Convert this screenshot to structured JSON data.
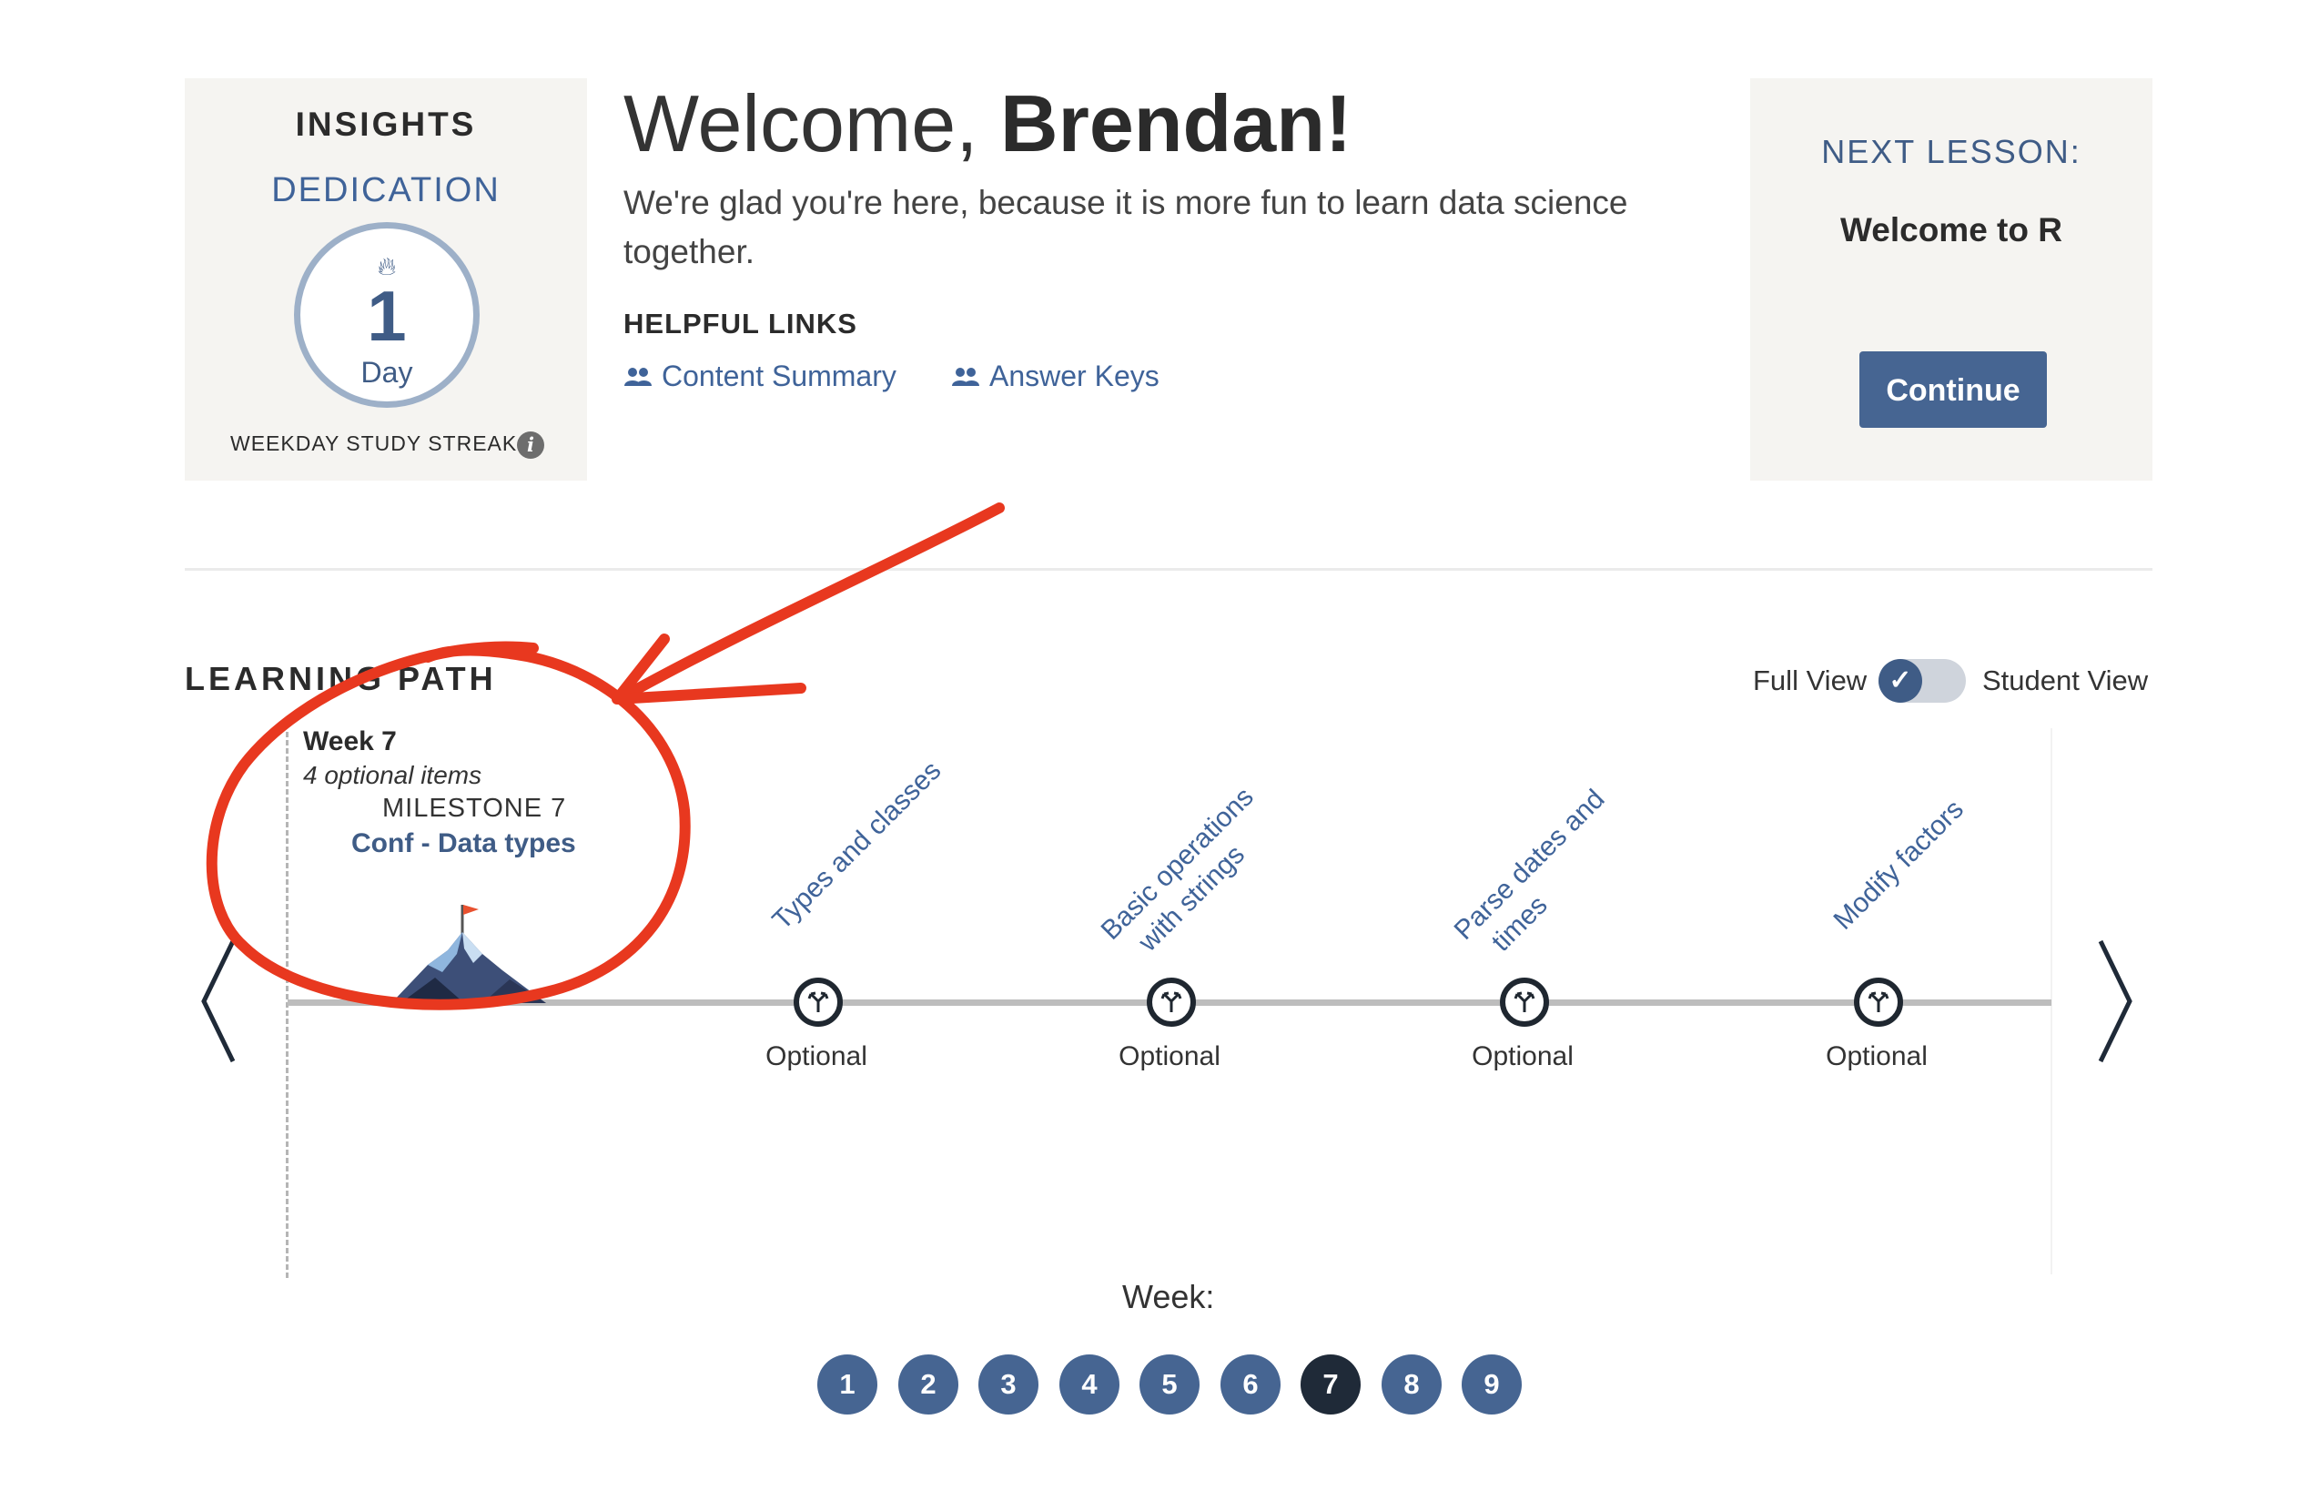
{
  "insights": {
    "title": "INSIGHTS",
    "subtitle": "DEDICATION",
    "streak_value": "1",
    "streak_unit": "Day",
    "streak_label": "WEEKDAY STUDY STREAK",
    "info_glyph": "i"
  },
  "welcome": {
    "greeting": "Welcome, ",
    "name": "Brendan!",
    "message": "We're glad you're here, because it is more fun to learn data science together."
  },
  "helpful_links": {
    "title": "HELPFUL LINKS",
    "links": [
      {
        "label": "Content Summary",
        "icon": "people-icon"
      },
      {
        "label": "Answer Keys",
        "icon": "people-icon"
      }
    ]
  },
  "next_lesson": {
    "title": "NEXT LESSON:",
    "name": "Welcome to R",
    "button_label": "Continue"
  },
  "learning_path": {
    "title": "LEARNING PATH",
    "view_toggle": {
      "left_label": "Full View",
      "right_label": "Student View",
      "state": "Full View"
    },
    "week_header": "Week 7",
    "week_subtitle": "4 optional items",
    "milestone_label": "MILESTONE 7",
    "milestone_name": "Conf - Data types",
    "items": [
      {
        "topic": "Types and classes",
        "status": "Optional"
      },
      {
        "topic": "Basic operations with strings",
        "topic_lines": [
          "Basic operations",
          "with strings"
        ],
        "status": "Optional"
      },
      {
        "topic": "Parse dates and times",
        "topic_lines": [
          "Parse dates and",
          "times"
        ],
        "status": "Optional"
      },
      {
        "topic": "Modify factors",
        "status": "Optional"
      }
    ]
  },
  "week_selector": {
    "label": "Week:",
    "weeks": [
      "1",
      "2",
      "3",
      "4",
      "5",
      "6",
      "7",
      "8",
      "9"
    ],
    "active": "7"
  },
  "colors": {
    "accent": "#3f5c86",
    "link": "#3f6399",
    "card_bg": "#f5f4f1",
    "annotation": "#e8381f",
    "active_week": "#1f2a38"
  }
}
